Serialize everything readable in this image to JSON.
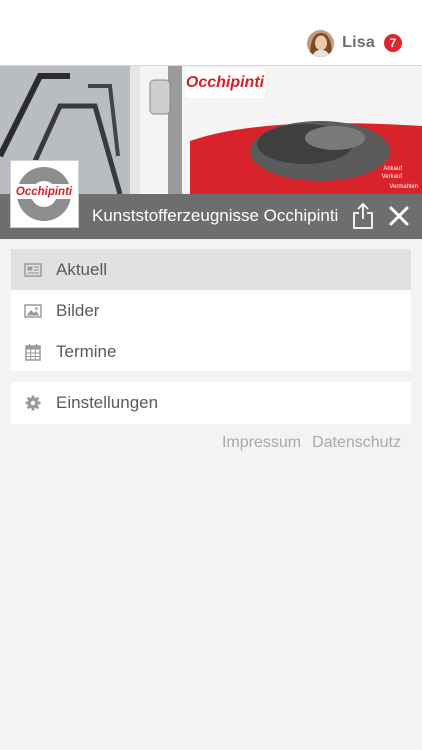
{
  "header": {
    "user_name": "Lisa",
    "notification_count": "7"
  },
  "banner": {
    "brand_text": "Occhipinti",
    "sign_text_1": "Ankauf",
    "sign_text_2": "Verkauf",
    "sign_text_3": "Vermahlen"
  },
  "titlebar": {
    "title": "Kunststofferzeugnisse Occhipinti",
    "logo_text": "Occhipinti"
  },
  "menu": {
    "items": [
      {
        "label": "Aktuell",
        "icon": "newspaper-icon",
        "active": true
      },
      {
        "label": "Bilder",
        "icon": "image-icon",
        "active": false
      },
      {
        "label": "Termine",
        "icon": "calendar-icon",
        "active": false
      }
    ],
    "settings": {
      "label": "Einstellungen",
      "icon": "gear-icon"
    }
  },
  "footer": {
    "impressum": "Impressum",
    "datenschutz": "Datenschutz"
  },
  "colors": {
    "badge": "#e0262c",
    "titlebar": "#6e6e6e",
    "brand_red": "#d41f26",
    "active_item": "#e1e1e1"
  }
}
